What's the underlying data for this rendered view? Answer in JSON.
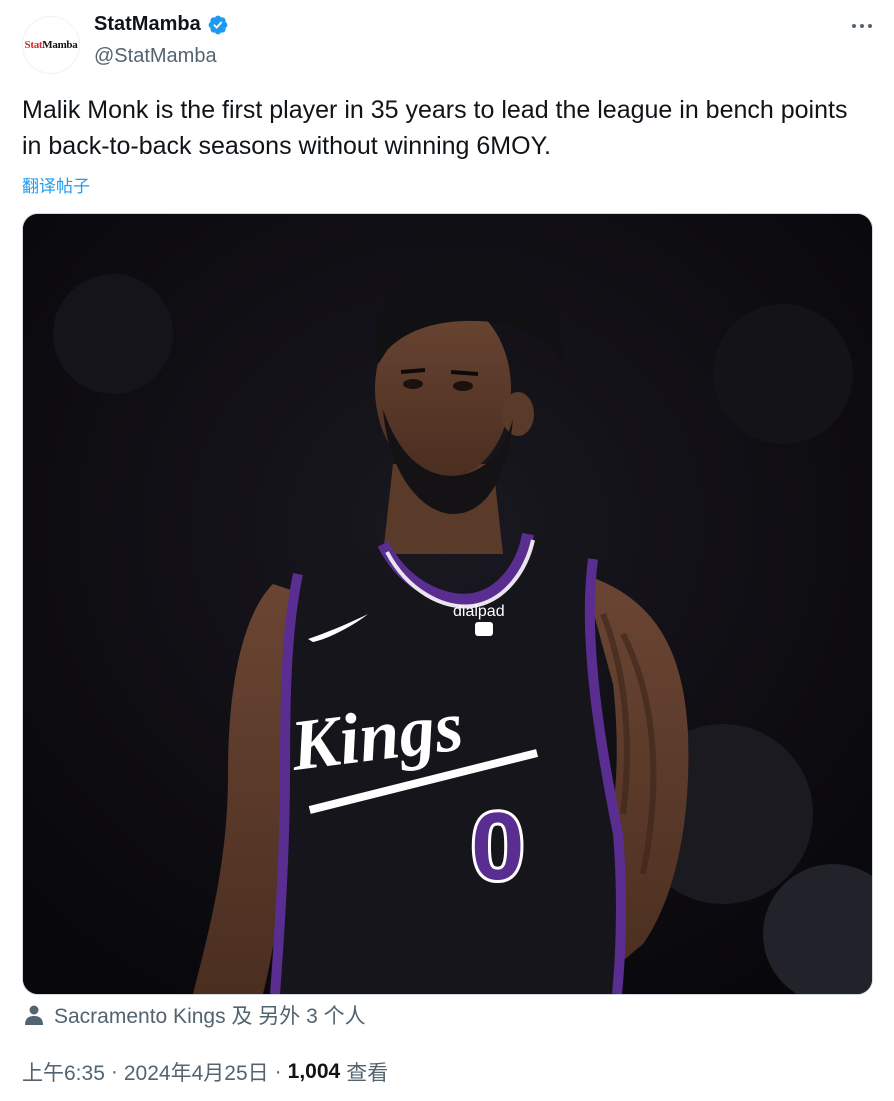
{
  "author": {
    "display_name": "StatMamba",
    "handle": "@StatMamba",
    "avatar_text_a": "Stat",
    "avatar_text_b": "Mamba",
    "verified_color": "#1d9bf0"
  },
  "tweet": {
    "text": "Malik Monk is the first player in 35 years to lead the league in bench points in back-to-back seasons without winning 6MOY.",
    "translate_label": "翻译帖子"
  },
  "media": {
    "jersey": {
      "sponsor": "dialpad",
      "team": "Kings",
      "number": "0"
    },
    "colors": {
      "background": "#0d0c10",
      "jersey": "#17151c",
      "trim": "#5a2d91",
      "skin": "#5b3a29"
    }
  },
  "tags": {
    "label": "Sacramento Kings 及 另外 3 个人"
  },
  "meta": {
    "time": "上午6:35",
    "date": "2024年4月25日",
    "views_count": "1,004",
    "views_label": "查看"
  }
}
